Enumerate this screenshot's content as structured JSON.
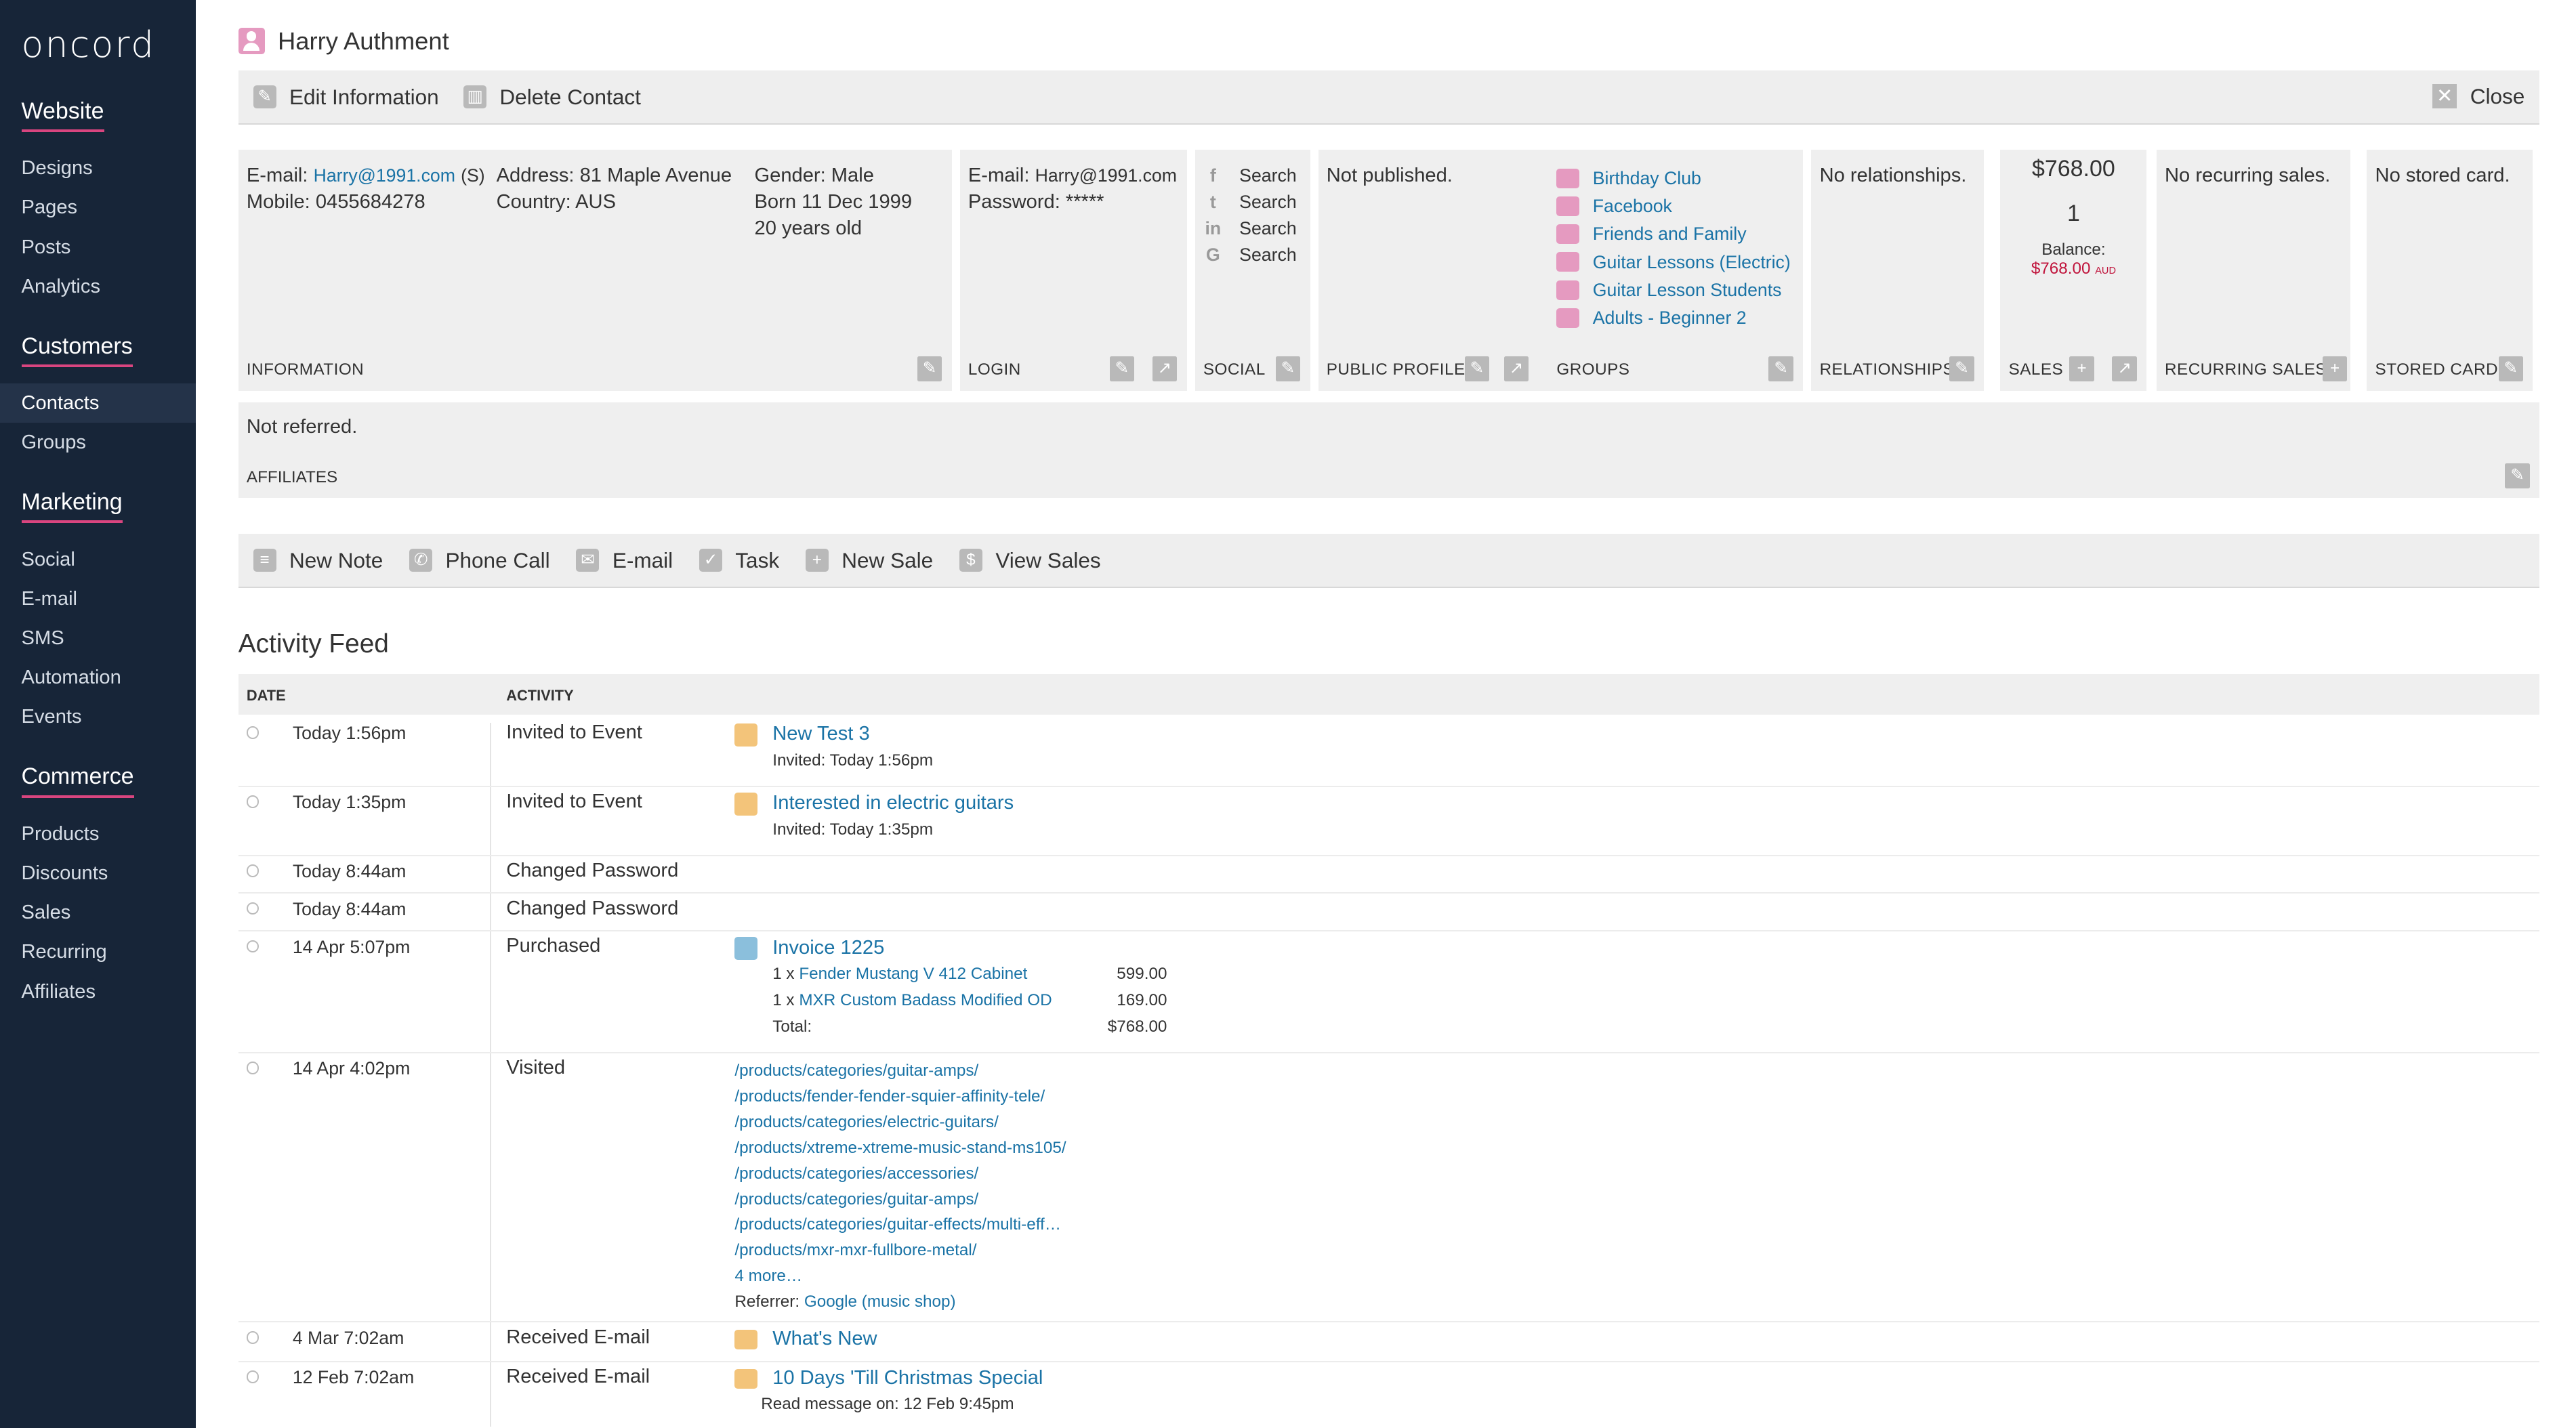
{
  "app": {
    "logo": "oncord"
  },
  "sidebar": {
    "sections": [
      {
        "heading": "Website",
        "items": [
          "Designs",
          "Pages",
          "Posts",
          "Analytics"
        ]
      },
      {
        "heading": "Customers",
        "items": [
          "Contacts",
          "Groups"
        ]
      },
      {
        "heading": "Marketing",
        "items": [
          "Social",
          "E-mail",
          "SMS",
          "Automation",
          "Events"
        ]
      },
      {
        "heading": "Commerce",
        "items": [
          "Products",
          "Discounts",
          "Sales",
          "Recurring",
          "Affiliates"
        ]
      }
    ],
    "active_item": "Contacts"
  },
  "contact": {
    "name": "Harry Authment"
  },
  "toolbar": {
    "edit": "Edit Information",
    "delete": "Delete Contact",
    "close": "Close"
  },
  "info": {
    "email_label": "E-mail:",
    "email": "Harry@1991.com",
    "email_suffix": "(S)",
    "mobile": "Mobile: 0455684278",
    "address": "Address: 81 Maple Avenue",
    "country": "Country: AUS",
    "gender": "Gender: Male",
    "born": "Born 11 Dec 1999",
    "age": "20 years old",
    "label": "INFORMATION"
  },
  "login": {
    "email_label": "E-mail:",
    "email": "Harry@1991.com",
    "password": "Password: *****",
    "label": "LOGIN"
  },
  "social": {
    "items": [
      "Search",
      "Search",
      "Search",
      "Search"
    ],
    "icons": [
      "facebook-icon",
      "twitter-icon",
      "linkedin-icon",
      "google-plus-icon"
    ],
    "label": "SOCIAL"
  },
  "public_profile": {
    "text": "Not published.",
    "label": "PUBLIC PROFILE"
  },
  "groups": {
    "items": [
      "Birthday Club",
      "Facebook",
      "Friends and Family",
      "Guitar Lessons (Electric)",
      "Guitar Lesson Students",
      "Adults - Beginner 2"
    ],
    "label": "GROUPS"
  },
  "relationships": {
    "text": "No relationships.",
    "label": "RELATIONSHIPS"
  },
  "sales": {
    "total": "$768.00",
    "count": "1",
    "balance_label": "Balance:",
    "balance": "$768.00",
    "currency": "AUD",
    "label": "SALES"
  },
  "recurring_sales": {
    "text": "No recurring sales.",
    "label": "RECURRING SALES"
  },
  "stored_card": {
    "text": "No stored card.",
    "label": "STORED CARD"
  },
  "affiliates": {
    "text": "Not referred.",
    "label": "AFFILIATES"
  },
  "actions": {
    "new_note": "New Note",
    "phone_call": "Phone Call",
    "email": "E-mail",
    "task": "Task",
    "new_sale": "New Sale",
    "view_sales": "View Sales"
  },
  "feed": {
    "title": "Activity Feed",
    "col_date": "DATE",
    "col_activity": "ACTIVITY",
    "rows": [
      {
        "date": "Today 1:56pm",
        "activity": "Invited to Event",
        "link": "New Test 3",
        "sub": "Invited: Today 1:56pm"
      },
      {
        "date": "Today 1:35pm",
        "activity": "Invited to Event",
        "link": "Interested in electric guitars",
        "sub": "Invited: Today 1:35pm"
      },
      {
        "date": "Today 8:44am",
        "activity": "Changed Password"
      },
      {
        "date": "Today 8:44am",
        "activity": "Changed Password"
      },
      {
        "date": "14 Apr 5:07pm",
        "activity": "Purchased",
        "link": "Invoice 1225",
        "lines": [
          {
            "qty": "1 x",
            "item": "Fender Mustang V 412 Cabinet",
            "price": "599.00"
          },
          {
            "qty": "1 x",
            "item": "MXR Custom Badass Modified OD",
            "price": "169.00"
          }
        ],
        "total_label": "Total:",
        "total": "$768.00"
      },
      {
        "date": "14 Apr 4:02pm",
        "activity": "Visited",
        "urls": [
          "/products/categories/guitar-amps/",
          "/products/fender-fender-squier-affinity-tele/",
          "/products/categories/electric-guitars/",
          "/products/xtreme-xtreme-music-stand-ms105/",
          "/products/categories/accessories/",
          "/products/categories/guitar-amps/",
          "/products/categories/guitar-effects/multi-eff…",
          "/products/mxr-mxr-fullbore-metal/"
        ],
        "more": "4 more…",
        "referrer_label": "Referrer:",
        "referrer": "Google (music shop)"
      },
      {
        "date": "4 Mar 7:02am",
        "activity": "Received E-mail",
        "link": "What's New"
      },
      {
        "date": "12 Feb 7:02am",
        "activity": "Received E-mail",
        "link": "10 Days 'Till Christmas Special",
        "sub": "Read message on: 12 Feb 9:45pm"
      }
    ]
  },
  "colors": {
    "sidebar_bg": "#172538",
    "accent": "#d9457f",
    "link": "#1a73a6",
    "balance": "#c0143c"
  }
}
